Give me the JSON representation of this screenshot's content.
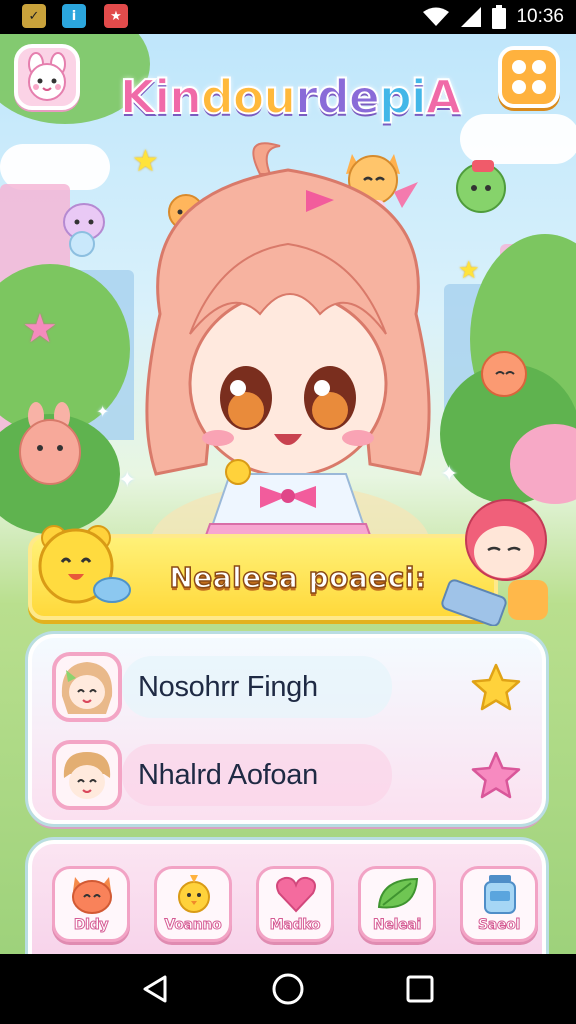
{
  "status_bar": {
    "time": "10:36",
    "apps": [
      "app-icon-1",
      "app-icon-2",
      "app-icon-3"
    ],
    "icons": [
      "wifi-icon",
      "signal-icon",
      "battery-icon"
    ]
  },
  "header": {
    "title_parts": [
      "Kin",
      "dou",
      "rde",
      "pi",
      "A"
    ],
    "icons": [
      "bunny-avatar-icon",
      "grid-menu-icon"
    ]
  },
  "banner": {
    "text": "Nealesa poaeci:"
  },
  "contacts": [
    {
      "name": "Nosohrr Fingh",
      "icon": "star-icon",
      "star_color": "#ffd23b"
    },
    {
      "name": "Nhalrd Aofoan",
      "icon": "star-icon",
      "star_color": "#f57ab8"
    }
  ],
  "toolbar": {
    "items": [
      {
        "label": "Dldy",
        "icon": "cat-icon"
      },
      {
        "label": "Voanno",
        "icon": "chick-icon"
      },
      {
        "label": "Madko",
        "icon": "heart-icon"
      },
      {
        "label": "Neleai",
        "icon": "leaf-icon"
      },
      {
        "label": "Saeol",
        "icon": "jar-icon"
      }
    ]
  },
  "colors": {
    "accent_pink": "#f06aa8",
    "banner_yellow": "#ffd93b",
    "menu_orange": "#ffb23e",
    "panel_border": "#b9dde2"
  }
}
